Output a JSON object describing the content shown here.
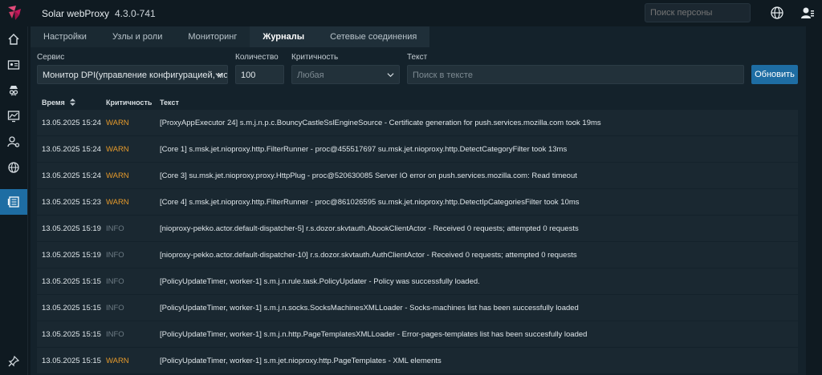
{
  "app": {
    "title": "Solar webProxy",
    "version": "4.3.0-741"
  },
  "top": {
    "search_placeholder": "Поиск персоны"
  },
  "tabs": [
    {
      "label": "Настройки"
    },
    {
      "label": "Узлы и роли"
    },
    {
      "label": "Мониторинг"
    },
    {
      "label": "Журналы"
    },
    {
      "label": "Сетевые соединения"
    }
  ],
  "filters": {
    "service_label": "Сервис",
    "service_value": "Монитор DPI(управление конфигурацией, мон...",
    "count_label": "Количество",
    "count_value": "100",
    "severity_label": "Критичность",
    "severity_placeholder": "Любая",
    "text_label": "Текст",
    "text_placeholder": "Поиск в тексте",
    "refresh_button": "Обновить"
  },
  "table": {
    "headers": {
      "time": "Время",
      "severity": "Критичность",
      "text": "Текст"
    },
    "rows": [
      {
        "time": "13.05.2025 15:24",
        "severity": "WARN",
        "text": "[ProxyAppExecutor 24] s.m.j.n.p.c.BouncyCastleSslEngineSource - Certificate generation for push.services.mozilla.com took 19ms"
      },
      {
        "time": "13.05.2025 15:24",
        "severity": "WARN",
        "text": "[Core 1] s.msk.jet.nioproxy.http.FilterRunner - proc@455517697 su.msk.jet.nioproxy.http.DetectCategoryFilter took 13ms"
      },
      {
        "time": "13.05.2025 15:24",
        "severity": "WARN",
        "text": "[Core 3] su.msk.jet.nioproxy.proxy.HttpPlug - proc@520630085 Server IO error on push.services.mozilla.com: Read timeout"
      },
      {
        "time": "13.05.2025 15:23",
        "severity": "WARN",
        "text": "[Core 4] s.msk.jet.nioproxy.http.FilterRunner - proc@861026595 su.msk.jet.nioproxy.http.DetectIpCategoriesFilter took 10ms"
      },
      {
        "time": "13.05.2025 15:19",
        "severity": "INFO",
        "text": "[nioproxy-pekko.actor.default-dispatcher-5] r.s.dozor.skvtauth.AbookClientActor - Received 0 requests; attempted 0 requests"
      },
      {
        "time": "13.05.2025 15:19",
        "severity": "INFO",
        "text": "[nioproxy-pekko.actor.default-dispatcher-10] r.s.dozor.skvtauth.AuthClientActor - Received 0 requests; attempted 0 requests"
      },
      {
        "time": "13.05.2025 15:15",
        "severity": "INFO",
        "text": "[PolicyUpdateTimer, worker-1] s.m.j.n.rule.task.PolicyUpdater - Policy was successfully loaded."
      },
      {
        "time": "13.05.2025 15:15",
        "severity": "INFO",
        "text": "[PolicyUpdateTimer, worker-1] s.m.j.n.socks.SocksMachinesXMLLoader - Socks-machines list has been successfully loaded"
      },
      {
        "time": "13.05.2025 15:15",
        "severity": "INFO",
        "text": "[PolicyUpdateTimer, worker-1] s.m.j.n.http.PageTemplatesXMLLoader - Error-pages-templates list has been succesfully loaded"
      },
      {
        "time": "13.05.2025 15:15",
        "severity": "WARN",
        "text": "[PolicyUpdateTimer, worker-1] s.m.jet.nioproxy.http.PageTemplates - XML elements"
      }
    ]
  },
  "colors": {
    "accent": "#1e6da3",
    "warn": "#e69a2b",
    "info": "#6e7c85",
    "logo": "#c2185b"
  }
}
